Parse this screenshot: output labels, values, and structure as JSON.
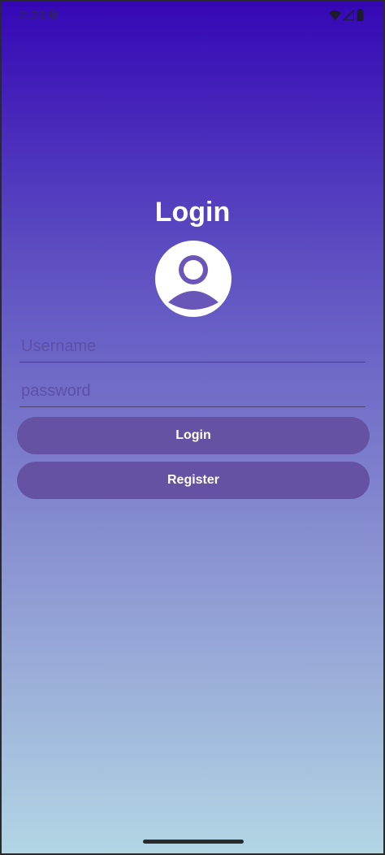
{
  "status_bar": {
    "time": "7:21",
    "icons": [
      "settings-gear-icon",
      "wifi-icon",
      "signal-icon",
      "battery-icon"
    ]
  },
  "login": {
    "title": "Login",
    "avatar_icon": "account-circle-icon",
    "username_placeholder": "Username",
    "username_value": "",
    "password_placeholder": "password",
    "password_value": "",
    "login_button": "Login",
    "register_button": "Register"
  },
  "colors": {
    "gradient_top": "#3507b5",
    "gradient_bottom": "#b2d6e4",
    "button": "#6552a3",
    "text_primary": "#ffffff"
  }
}
